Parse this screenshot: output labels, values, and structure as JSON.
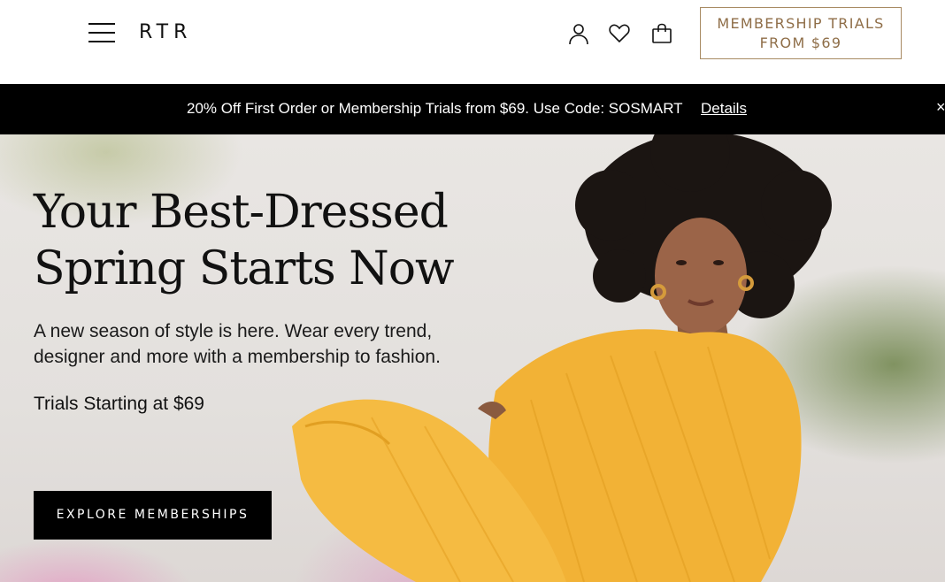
{
  "header": {
    "logo": "RTR",
    "icons": [
      "hamburger-menu-icon",
      "account-icon",
      "heart-icon",
      "shopping-bag-icon"
    ],
    "membership_button": {
      "line1": "MEMBERSHIP TRIALS",
      "line2": "FROM $69"
    }
  },
  "promo": {
    "text": "20% Off First Order or Membership Trials from $69. Use Code: SOSMART",
    "link": "Details",
    "close": "×"
  },
  "hero": {
    "title_line1": "Your Best-Dressed",
    "title_line2": "Spring Starts Now",
    "subtitle": "A new season of style is here. Wear every trend, designer and more with a membership to fashion.",
    "trials": "Trials Starting at $69",
    "cta": "EXPLORE MEMBERSHIPS"
  },
  "colors": {
    "accent_gold": "#8f6e48",
    "promo_bg": "#000000",
    "dress_yellow": "#f4b63a"
  }
}
